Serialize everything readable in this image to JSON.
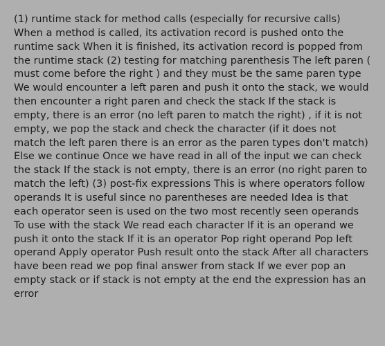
{
  "body_text": "(1) runtime stack for method calls (especially for recursive calls) When a method is called, its activation record is pushed onto the runtime sack When it is finished, its activation record is popped from the runtime stack (2) testing for matching parenthesis The left paren ( must come before the right ) and they must be the same paren type We would encounter a left paren and push it onto the stack, we would then encounter a right paren and check the stack If the stack is empty, there is an error (no left paren to match the right) , if it is not empty, we pop the stack and check the character (if it does not match the left paren there is an error as the paren types don't match) Else we continue Once we have read in all of the input we can check the stack If the stack is not empty, there is an error (no right paren to match the left) (3) post-fix expressions This is where operators follow operands It is useful since no parentheses are needed Idea is that each operator seen is used on the two most recently seen operands To use with the stack We read each character If it is an operand we push it onto the stack If it is an operator Pop right operand Pop left operand Apply operator Push result onto the stack After all characters have been read we pop final answer from stack If we ever pop an empty stack or if stack is not empty at the end the expression has an error"
}
